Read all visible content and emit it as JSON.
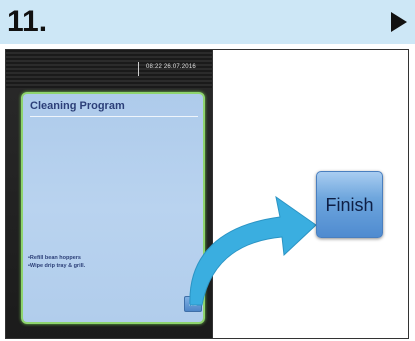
{
  "header": {
    "step_number": "11."
  },
  "device": {
    "status": {
      "time_date": "08:22  26.07.2016"
    },
    "screen": {
      "title": "Cleaning Program",
      "instructions": [
        "•Refill bean hoppers",
        "•Wipe drip tray & grill."
      ],
      "mini_button_label": "Finish"
    }
  },
  "callout": {
    "finish_label": "Finish"
  },
  "colors": {
    "header_bg": "#cde7f6",
    "screen_border": "#8ed46e",
    "screen_bg": "#b4cfed",
    "title_text": "#2c3f78",
    "arrow": "#3aaee0",
    "button_bg": "#6ea6dd"
  },
  "icons": {
    "next": "next-arrow-icon",
    "pointer": "curved-pointer-arrow-icon"
  }
}
